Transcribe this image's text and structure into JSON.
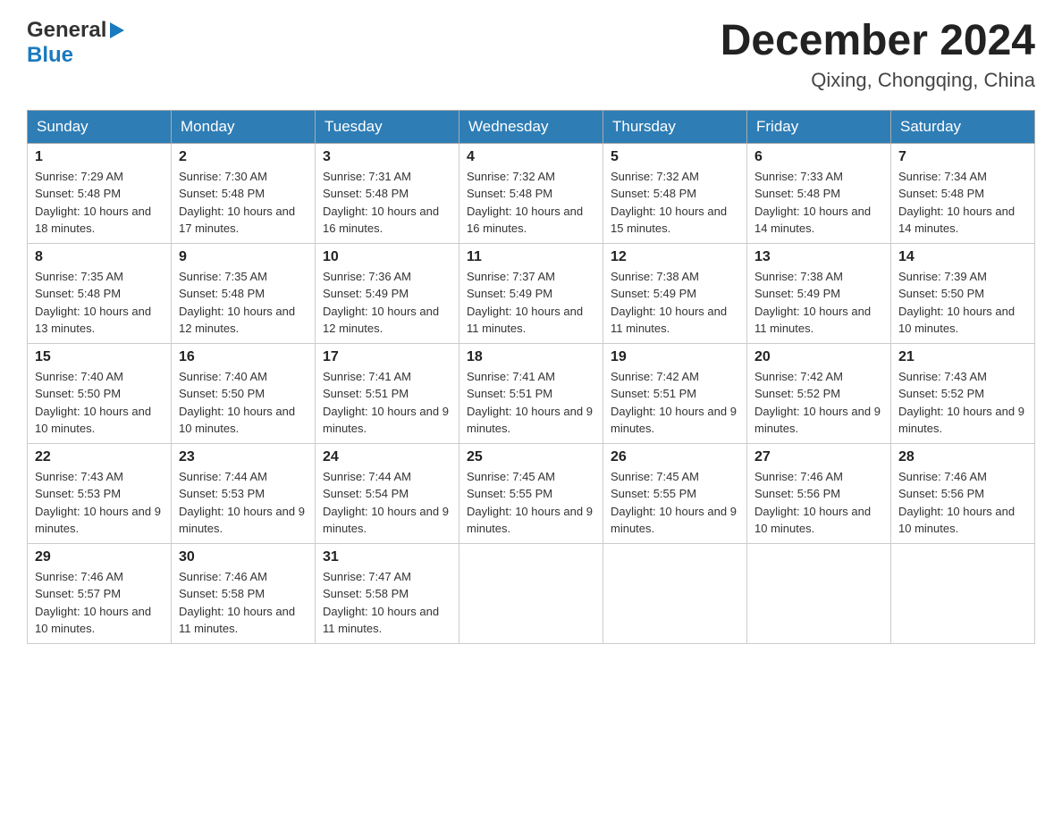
{
  "header": {
    "logo_general": "General",
    "logo_blue": "Blue",
    "month_title": "December 2024",
    "location": "Qixing, Chongqing, China"
  },
  "weekdays": [
    "Sunday",
    "Monday",
    "Tuesday",
    "Wednesday",
    "Thursday",
    "Friday",
    "Saturday"
  ],
  "weeks": [
    [
      {
        "day": "1",
        "sunrise": "7:29 AM",
        "sunset": "5:48 PM",
        "daylight": "10 hours and 18 minutes."
      },
      {
        "day": "2",
        "sunrise": "7:30 AM",
        "sunset": "5:48 PM",
        "daylight": "10 hours and 17 minutes."
      },
      {
        "day": "3",
        "sunrise": "7:31 AM",
        "sunset": "5:48 PM",
        "daylight": "10 hours and 16 minutes."
      },
      {
        "day": "4",
        "sunrise": "7:32 AM",
        "sunset": "5:48 PM",
        "daylight": "10 hours and 16 minutes."
      },
      {
        "day": "5",
        "sunrise": "7:32 AM",
        "sunset": "5:48 PM",
        "daylight": "10 hours and 15 minutes."
      },
      {
        "day": "6",
        "sunrise": "7:33 AM",
        "sunset": "5:48 PM",
        "daylight": "10 hours and 14 minutes."
      },
      {
        "day": "7",
        "sunrise": "7:34 AM",
        "sunset": "5:48 PM",
        "daylight": "10 hours and 14 minutes."
      }
    ],
    [
      {
        "day": "8",
        "sunrise": "7:35 AM",
        "sunset": "5:48 PM",
        "daylight": "10 hours and 13 minutes."
      },
      {
        "day": "9",
        "sunrise": "7:35 AM",
        "sunset": "5:48 PM",
        "daylight": "10 hours and 12 minutes."
      },
      {
        "day": "10",
        "sunrise": "7:36 AM",
        "sunset": "5:49 PM",
        "daylight": "10 hours and 12 minutes."
      },
      {
        "day": "11",
        "sunrise": "7:37 AM",
        "sunset": "5:49 PM",
        "daylight": "10 hours and 11 minutes."
      },
      {
        "day": "12",
        "sunrise": "7:38 AM",
        "sunset": "5:49 PM",
        "daylight": "10 hours and 11 minutes."
      },
      {
        "day": "13",
        "sunrise": "7:38 AM",
        "sunset": "5:49 PM",
        "daylight": "10 hours and 11 minutes."
      },
      {
        "day": "14",
        "sunrise": "7:39 AM",
        "sunset": "5:50 PM",
        "daylight": "10 hours and 10 minutes."
      }
    ],
    [
      {
        "day": "15",
        "sunrise": "7:40 AM",
        "sunset": "5:50 PM",
        "daylight": "10 hours and 10 minutes."
      },
      {
        "day": "16",
        "sunrise": "7:40 AM",
        "sunset": "5:50 PM",
        "daylight": "10 hours and 10 minutes."
      },
      {
        "day": "17",
        "sunrise": "7:41 AM",
        "sunset": "5:51 PM",
        "daylight": "10 hours and 9 minutes."
      },
      {
        "day": "18",
        "sunrise": "7:41 AM",
        "sunset": "5:51 PM",
        "daylight": "10 hours and 9 minutes."
      },
      {
        "day": "19",
        "sunrise": "7:42 AM",
        "sunset": "5:51 PM",
        "daylight": "10 hours and 9 minutes."
      },
      {
        "day": "20",
        "sunrise": "7:42 AM",
        "sunset": "5:52 PM",
        "daylight": "10 hours and 9 minutes."
      },
      {
        "day": "21",
        "sunrise": "7:43 AM",
        "sunset": "5:52 PM",
        "daylight": "10 hours and 9 minutes."
      }
    ],
    [
      {
        "day": "22",
        "sunrise": "7:43 AM",
        "sunset": "5:53 PM",
        "daylight": "10 hours and 9 minutes."
      },
      {
        "day": "23",
        "sunrise": "7:44 AM",
        "sunset": "5:53 PM",
        "daylight": "10 hours and 9 minutes."
      },
      {
        "day": "24",
        "sunrise": "7:44 AM",
        "sunset": "5:54 PM",
        "daylight": "10 hours and 9 minutes."
      },
      {
        "day": "25",
        "sunrise": "7:45 AM",
        "sunset": "5:55 PM",
        "daylight": "10 hours and 9 minutes."
      },
      {
        "day": "26",
        "sunrise": "7:45 AM",
        "sunset": "5:55 PM",
        "daylight": "10 hours and 9 minutes."
      },
      {
        "day": "27",
        "sunrise": "7:46 AM",
        "sunset": "5:56 PM",
        "daylight": "10 hours and 10 minutes."
      },
      {
        "day": "28",
        "sunrise": "7:46 AM",
        "sunset": "5:56 PM",
        "daylight": "10 hours and 10 minutes."
      }
    ],
    [
      {
        "day": "29",
        "sunrise": "7:46 AM",
        "sunset": "5:57 PM",
        "daylight": "10 hours and 10 minutes."
      },
      {
        "day": "30",
        "sunrise": "7:46 AM",
        "sunset": "5:58 PM",
        "daylight": "10 hours and 11 minutes."
      },
      {
        "day": "31",
        "sunrise": "7:47 AM",
        "sunset": "5:58 PM",
        "daylight": "10 hours and 11 minutes."
      },
      null,
      null,
      null,
      null
    ]
  ],
  "labels": {
    "sunrise_prefix": "Sunrise: ",
    "sunset_prefix": "Sunset: ",
    "daylight_prefix": "Daylight: "
  }
}
